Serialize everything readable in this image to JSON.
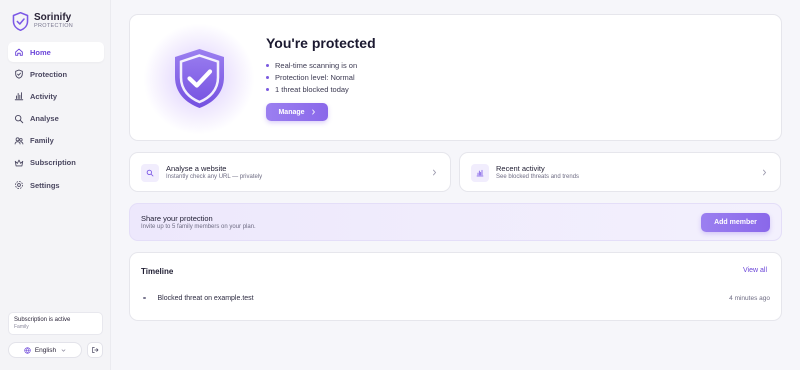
{
  "brand": {
    "name": "Sorinify",
    "subtitle": "PROTECTION"
  },
  "nav": [
    {
      "label": "Home",
      "icon": "home-icon",
      "active": true
    },
    {
      "label": "Protection",
      "icon": "shield-icon"
    },
    {
      "label": "Activity",
      "icon": "bar-chart-icon"
    },
    {
      "label": "Analyse",
      "icon": "search-icon"
    },
    {
      "label": "Family",
      "icon": "users-icon"
    },
    {
      "label": "Subscription",
      "icon": "crown-icon"
    },
    {
      "label": "Settings",
      "icon": "gear-icon"
    }
  ],
  "subscription": {
    "status": "Subscription is active",
    "plan": "Family"
  },
  "language": {
    "label": "English"
  },
  "hero": {
    "title": "You're protected",
    "bullets": [
      "Real-time scanning is on",
      "Protection level: Normal",
      "1 threat blocked today"
    ],
    "button": "Manage"
  },
  "actions": [
    {
      "title": "Analyse a website",
      "subtitle": "Instantly check any URL — privately",
      "icon": "search-icon"
    },
    {
      "title": "Recent activity",
      "subtitle": "See blocked threats and trends",
      "icon": "bar-chart-icon"
    }
  ],
  "share": {
    "title": "Share your protection",
    "subtitle": "Invite up to 5 family members on your plan.",
    "button": "Add member"
  },
  "timeline": {
    "title": "Timeline",
    "view_all": "View all",
    "items": [
      {
        "text": "Blocked threat on example.test",
        "time": "4 minutes ago"
      }
    ]
  },
  "colors": {
    "accent": "#7b58e6",
    "accent_light": "#ede8fc",
    "background": "#f6f6fa"
  }
}
